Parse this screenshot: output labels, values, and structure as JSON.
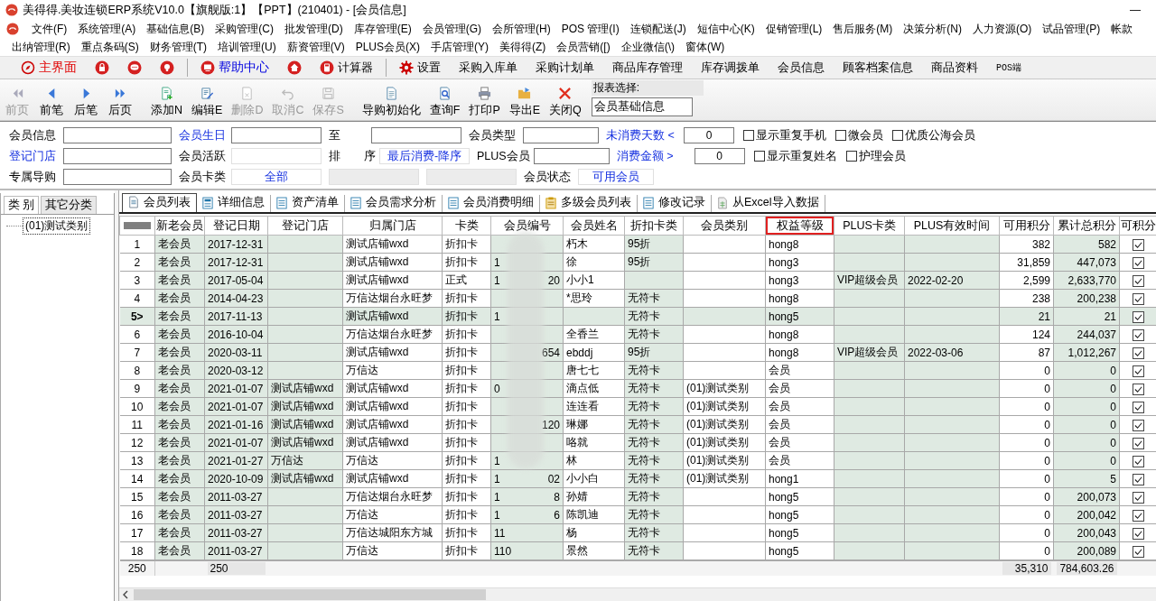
{
  "window": {
    "title": "美得得.美妆连锁ERP系统V10.0【旗舰版:1】【PPT】(210401) - [会员信息]",
    "minimize": "—"
  },
  "menu_rows": [
    [
      "文件(F)",
      "系统管理(A)",
      "基础信息(B)",
      "采购管理(C)",
      "批发管理(D)",
      "库存管理(E)",
      "会员管理(G)",
      "会所管理(H)",
      "POS 管理(I)",
      "连锁配送(J)",
      "短信中心(K)",
      "促销管理(L)",
      "售后服务(M)",
      "决策分析(N)",
      "人力资源(O)",
      "试品管理(P)",
      "帐款"
    ],
    [
      "出纳管理(R)",
      "重点条码(S)",
      "财务管理(T)",
      "培训管理(U)",
      "薪资管理(V)",
      "PLUS会员(X)",
      "手店管理(Y)",
      "美得得(Z)",
      "会员营销([)",
      "企业微信(\\)",
      "窗体(W)"
    ]
  ],
  "quick_bar": [
    {
      "kind": "button",
      "label": "主界面",
      "color": "#e00000"
    },
    {
      "kind": "button"
    },
    {
      "kind": "button"
    },
    {
      "kind": "button"
    },
    {
      "kind": "separator"
    },
    {
      "kind": "button",
      "label": "帮助中心",
      "color": "#0000e0"
    },
    {
      "kind": "button"
    },
    {
      "kind": "button",
      "label": "计算器"
    },
    {
      "kind": "separator"
    },
    {
      "kind": "button",
      "label": "设置"
    },
    {
      "label": "采购入库单"
    },
    {
      "label": "采购计划单"
    },
    {
      "label": "商品库存管理"
    },
    {
      "label": "库存调拨单"
    },
    {
      "label": "会员信息"
    },
    {
      "label": "顾客档案信息"
    },
    {
      "label": "商品资料"
    },
    {
      "label": "POS端"
    }
  ],
  "toolbar": [
    {
      "label": "前页",
      "disabled": true
    },
    {
      "label": "前笔",
      "disabled": false
    },
    {
      "label": "后笔",
      "disabled": false
    },
    {
      "label": "后页",
      "disabled": false
    },
    {
      "label": "添加N",
      "disabled": false
    },
    {
      "label": "编辑E",
      "disabled": false
    },
    {
      "label": "删除D",
      "disabled": true
    },
    {
      "label": "取消C",
      "disabled": true
    },
    {
      "label": "保存S",
      "disabled": true
    },
    {
      "label": "导购初始化",
      "disabled": false
    },
    {
      "label": "查询F",
      "disabled": false
    },
    {
      "label": "打印P",
      "disabled": false
    },
    {
      "label": "导出E",
      "disabled": false
    },
    {
      "label": "关闭Q",
      "disabled": false
    }
  ],
  "report_select": {
    "label": "报表选择:",
    "value": "会员基础信息"
  },
  "filters": [
    [
      {
        "kind": "label",
        "text": "会员信息"
      },
      {
        "kind": "field"
      },
      {
        "kind": "link",
        "text": "会员生日"
      },
      {
        "kind": "field"
      },
      {
        "kind": "label",
        "text": "至"
      },
      {
        "kind": "field"
      },
      {
        "kind": "label",
        "text": "会员类型"
      },
      {
        "kind": "field"
      },
      {
        "kind": "link",
        "text": "未消费天数 <"
      },
      {
        "kind": "number",
        "value": "0"
      },
      {
        "kind": "checkbox",
        "text": "显示重复手机",
        "checked": false
      },
      {
        "kind": "checkbox",
        "text": "微会员",
        "checked": false
      },
      {
        "kind": "checkbox",
        "text": "优质公海会员",
        "checked": false
      }
    ],
    [
      {
        "kind": "link",
        "text": "登记门店"
      },
      {
        "kind": "field"
      },
      {
        "kind": "label",
        "text": "会员活跃"
      },
      {
        "kind": "select"
      },
      {
        "kind": "label",
        "text": "排　　序"
      },
      {
        "kind": "select",
        "value": "最后消费-降序"
      },
      {
        "kind": "label",
        "text": "PLUS会员"
      },
      {
        "kind": "field"
      },
      {
        "kind": "link",
        "text": "消费金额 >"
      },
      {
        "kind": "number",
        "value": "0"
      },
      {
        "kind": "checkbox",
        "text": "显示重复姓名",
        "checked": false
      },
      {
        "kind": "checkbox",
        "text": "护理会员",
        "checked": false
      }
    ],
    [
      {
        "kind": "label",
        "text": "专属导购"
      },
      {
        "kind": "field"
      },
      {
        "kind": "label",
        "text": "会员卡类"
      },
      {
        "kind": "select",
        "value": "全部"
      },
      {
        "kind": "blank"
      },
      {
        "kind": "blank"
      },
      {
        "kind": "label",
        "text": "会员状态"
      },
      {
        "kind": "select",
        "value": "可用会员"
      }
    ]
  ],
  "side_tabs": [
    {
      "label": "类 别",
      "selected": true
    },
    {
      "label": "其它分类",
      "selected": false
    }
  ],
  "tree": [
    {
      "label": "(01)测试类别",
      "selected": true
    }
  ],
  "tabs": [
    {
      "label": "会员列表",
      "selected": true
    },
    {
      "label": "详细信息",
      "selected": false
    },
    {
      "label": "资产清单",
      "selected": false
    },
    {
      "label": "会员需求分析",
      "selected": false
    },
    {
      "label": "会员消费明细",
      "selected": false
    },
    {
      "label": "多级会员列表",
      "selected": false
    },
    {
      "label": "修改记录",
      "selected": false
    },
    {
      "label": "从Excel导入数据",
      "selected": false
    }
  ],
  "table": {
    "columns": [
      {
        "label": "新老会员",
        "kind": "text",
        "shaded": true
      },
      {
        "label": "登记日期",
        "kind": "text",
        "shaded": true
      },
      {
        "label": "登记门店",
        "kind": "text",
        "shaded": true
      },
      {
        "label": "归属门店",
        "kind": "text",
        "shaded": false
      },
      {
        "label": "卡类",
        "kind": "text",
        "shaded": false
      },
      {
        "label": "会员编号",
        "kind": "masked",
        "shaded": true
      },
      {
        "label": "会员姓名",
        "kind": "text",
        "shaded": false
      },
      {
        "label": "折扣卡类",
        "kind": "text",
        "shaded": true
      },
      {
        "label": "会员类别",
        "kind": "text",
        "shaded": false
      },
      {
        "label": "权益等级",
        "kind": "text",
        "shaded": false,
        "highlighted": true
      },
      {
        "label": "PLUS卡类",
        "kind": "text",
        "shaded": true
      },
      {
        "label": "PLUS有效时间",
        "kind": "text",
        "shaded": true
      },
      {
        "label": "可用积分",
        "kind": "number",
        "shaded": false
      },
      {
        "label": "累计总积分",
        "kind": "number",
        "shaded": true
      },
      {
        "label": "可积分",
        "kind": "check",
        "shaded": false
      }
    ],
    "rows": [
      {
        "no": "1",
        "selected": false,
        "cells": [
          "老会员",
          "2017-12-31",
          null,
          "测试店铺wxd",
          "折扣卡",
          {},
          "朽木",
          "95折",
          null,
          "hong8",
          null,
          null,
          "382",
          "582",
          true
        ]
      },
      {
        "no": "2",
        "selected": false,
        "cells": [
          "老会员",
          "2017-12-31",
          null,
          "测试店铺wxd",
          "折扣卡",
          {
            "start": "1"
          },
          "徐",
          "95折",
          null,
          "hong3",
          null,
          null,
          "31,859",
          "447,073",
          true
        ]
      },
      {
        "no": "3",
        "selected": false,
        "cells": [
          "老会员",
          "2017-05-04",
          null,
          "测试店铺wxd",
          "正式",
          {
            "start": "1",
            "end": "20"
          },
          "小小1",
          null,
          null,
          "hong3",
          "VIP超级会员",
          "2022-02-20",
          "2,599",
          "2,633,770",
          true
        ]
      },
      {
        "no": "4",
        "selected": false,
        "cells": [
          "老会员",
          "2014-04-23",
          null,
          "万信达烟台永旺梦",
          "折扣卡",
          {},
          "*思玲",
          "无符卡",
          null,
          "hong8",
          null,
          null,
          "238",
          "200,238",
          true
        ]
      },
      {
        "no": "5>",
        "selected": true,
        "cells": [
          "老会员",
          "2017-11-13",
          null,
          "测试店铺wxd",
          "折扣卡",
          {
            "start": "1"
          },
          null,
          "无符卡",
          null,
          "hong5",
          null,
          null,
          "21",
          "21",
          true
        ]
      },
      {
        "no": "6",
        "selected": false,
        "cells": [
          "老会员",
          "2016-10-04",
          null,
          "万信达烟台永旺梦",
          "折扣卡",
          {},
          "全香兰",
          "无符卡",
          null,
          "hong8",
          null,
          null,
          "124",
          "244,037",
          true
        ]
      },
      {
        "no": "7",
        "selected": false,
        "cells": [
          "老会员",
          "2020-03-11",
          null,
          "测试店铺wxd",
          "折扣卡",
          {
            "end": "654"
          },
          "ebddj",
          "95折",
          null,
          "hong8",
          "VIP超级会员",
          "2022-03-06",
          "87",
          "1,012,267",
          true
        ]
      },
      {
        "no": "8",
        "selected": false,
        "cells": [
          "老会员",
          "2020-03-12",
          null,
          "万信达",
          "折扣卡",
          {},
          "唐七七",
          "无符卡",
          null,
          "会员",
          null,
          null,
          "0",
          "0",
          true
        ]
      },
      {
        "no": "9",
        "selected": false,
        "cells": [
          "老会员",
          "2021-01-07",
          "测试店铺wxd",
          "测试店铺wxd",
          "折扣卡",
          {
            "start": "0"
          },
          "滴点低",
          "无符卡",
          "(01)测试类别",
          "会员",
          null,
          null,
          "0",
          "0",
          true
        ]
      },
      {
        "no": "10",
        "selected": false,
        "cells": [
          "老会员",
          "2021-01-07",
          "测试店铺wxd",
          "测试店铺wxd",
          "折扣卡",
          {},
          "连连看",
          "无符卡",
          "(01)测试类别",
          "会员",
          null,
          null,
          "0",
          "0",
          true
        ]
      },
      {
        "no": "11",
        "selected": false,
        "cells": [
          "老会员",
          "2021-01-16",
          "测试店铺wxd",
          "测试店铺wxd",
          "折扣卡",
          {
            "end": "120"
          },
          "琳娜",
          "无符卡",
          "(01)测试类别",
          "会员",
          null,
          null,
          "0",
          "0",
          true
        ]
      },
      {
        "no": "12",
        "selected": false,
        "cells": [
          "老会员",
          "2021-01-07",
          "测试店铺wxd",
          "测试店铺wxd",
          "折扣卡",
          {},
          "咯就",
          "无符卡",
          "(01)测试类别",
          "会员",
          null,
          null,
          "0",
          "0",
          true
        ]
      },
      {
        "no": "13",
        "selected": false,
        "cells": [
          "老会员",
          "2021-01-27",
          "万信达",
          "万信达",
          "折扣卡",
          {
            "start": "1"
          },
          "林",
          "无符卡",
          "(01)测试类别",
          "会员",
          null,
          null,
          "0",
          "0",
          true
        ]
      },
      {
        "no": "14",
        "selected": false,
        "cells": [
          "老会员",
          "2020-10-09",
          "测试店铺wxd",
          "测试店铺wxd",
          "折扣卡",
          {
            "start": "1",
            "end": "02"
          },
          "小小白",
          "无符卡",
          "(01)测试类别",
          "hong1",
          null,
          null,
          "0",
          "5",
          true
        ]
      },
      {
        "no": "15",
        "selected": false,
        "cells": [
          "老会员",
          "2011-03-27",
          null,
          "万信达烟台永旺梦",
          "折扣卡",
          {
            "start": "1",
            "end": "8"
          },
          "孙婧",
          "无符卡",
          null,
          "hong5",
          null,
          null,
          "0",
          "200,073",
          true
        ]
      },
      {
        "no": "16",
        "selected": false,
        "cells": [
          "老会员",
          "2011-03-27",
          null,
          "万信达",
          "折扣卡",
          {
            "start": "1",
            "end": "6"
          },
          "陈凯迪",
          "无符卡",
          null,
          "hong5",
          null,
          null,
          "0",
          "200,042",
          true
        ]
      },
      {
        "no": "17",
        "selected": false,
        "cells": [
          "老会员",
          "2011-03-27",
          null,
          "万信达城阳东方城",
          "折扣卡",
          {
            "start": "11"
          },
          "杨",
          "无符卡",
          null,
          "hong5",
          null,
          null,
          "0",
          "200,043",
          true
        ]
      },
      {
        "no": "18",
        "selected": false,
        "cells": [
          "老会员",
          "2011-03-27",
          null,
          "万信达",
          "折扣卡",
          {
            "start": "110"
          },
          "景然",
          "无符卡",
          null,
          "hong5",
          null,
          null,
          "0",
          "200,089",
          true
        ]
      }
    ],
    "footer": {
      "count": "250",
      "date_count": "250",
      "points_total": "35,310",
      "total_points_sum": "784,603.26"
    }
  }
}
